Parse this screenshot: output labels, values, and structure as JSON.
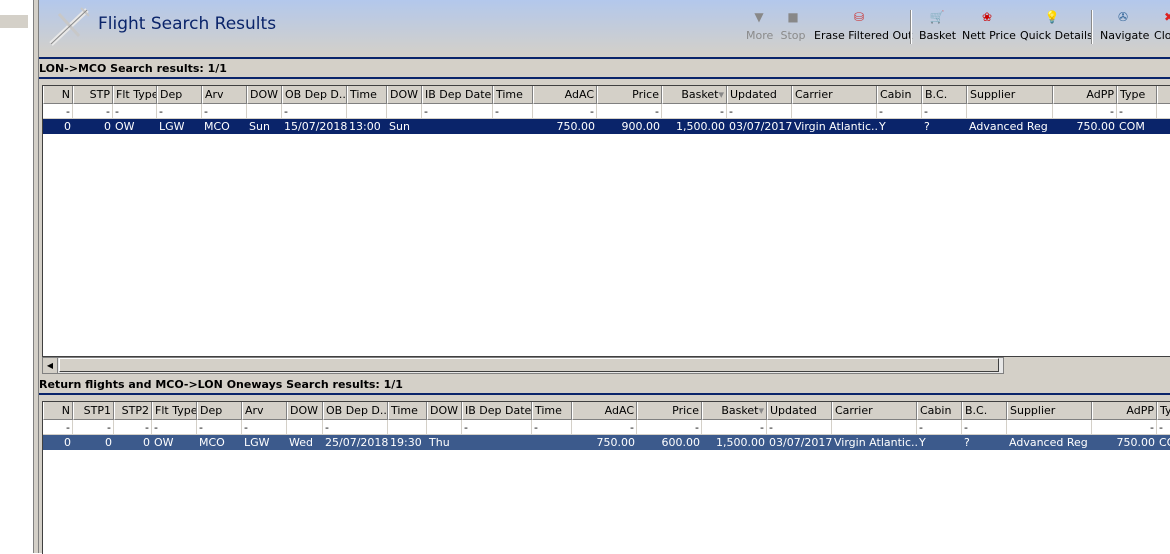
{
  "window": {
    "title": "Flight Search Results"
  },
  "toolbar": [
    {
      "label": "More",
      "icon": "more-icon",
      "disabled": true
    },
    {
      "label": "Stop",
      "icon": "stop-icon",
      "disabled": true
    },
    {
      "label": "Erase Filtered Out",
      "icon": "erase-icon",
      "disabled": false
    },
    {
      "label": "Basket",
      "icon": "basket-icon",
      "disabled": false
    },
    {
      "label": "Nett Price",
      "icon": "nett-price-icon",
      "disabled": false
    },
    {
      "label": "Quick Details",
      "icon": "lightbulb-icon",
      "disabled": false
    },
    {
      "label": "Navigate",
      "icon": "navigate-icon",
      "disabled": false
    },
    {
      "label": "Close",
      "icon": "close-icon",
      "disabled": false
    }
  ],
  "outbound": {
    "title": "LON->MCO Search results: 1/1",
    "columns": [
      "N",
      "STP",
      "Flt Type",
      "Dep",
      "Arv",
      "DOW",
      "OB Dep D...",
      "Time",
      "DOW",
      "IB Dep Date",
      "Time",
      "AdAC",
      "Price",
      "Basket",
      "Updated",
      "Carrier",
      "Cabin",
      "B.C.",
      "Supplier",
      "AdPP",
      "Type",
      ""
    ],
    "filter": [
      "-",
      "-",
      "-",
      "-",
      "-",
      "",
      "-",
      "",
      "",
      "-",
      "-",
      "-",
      "-",
      "-",
      "-",
      "",
      "-",
      "-",
      "",
      "-",
      "-",
      ""
    ],
    "rows": [
      [
        "0",
        "0",
        "OW",
        "LGW",
        "MCO",
        "Sun",
        "15/07/2018",
        "13:00",
        "Sun",
        "",
        "",
        "750.00",
        "900.00",
        "1,500.00",
        "03/07/2017",
        "Virgin Atlantic...",
        "Y",
        "?",
        "Advanced Reg",
        "750.00",
        "COM",
        ""
      ]
    ]
  },
  "return": {
    "title": "Return flights and MCO->LON Oneways Search results: 1/1",
    "columns": [
      "N",
      "STP1",
      "STP2",
      "Flt Type",
      "Dep",
      "Arv",
      "DOW",
      "OB Dep D...",
      "Time",
      "DOW",
      "IB Dep Date",
      "Time",
      "AdAC",
      "Price",
      "Basket",
      "Updated",
      "Carrier",
      "Cabin",
      "B.C.",
      "Supplier",
      "AdPP",
      "Ty"
    ],
    "filter": [
      "-",
      "-",
      "-",
      "-",
      "-",
      "-",
      "",
      "-",
      "",
      "",
      "-",
      "-",
      "-",
      "-",
      "-",
      "-",
      "",
      "-",
      "-",
      "",
      "-",
      "-"
    ],
    "rows": [
      [
        "0",
        "0",
        "0",
        "OW",
        "MCO",
        "LGW",
        "Wed",
        "25/07/2018",
        "19:30",
        "Thu",
        "",
        "",
        "750.00",
        "600.00",
        "1,500.00",
        "03/07/2017",
        "Virgin Atlantic...",
        "Y",
        "?",
        "Advanced Reg",
        "750.00",
        "COM"
      ]
    ]
  }
}
